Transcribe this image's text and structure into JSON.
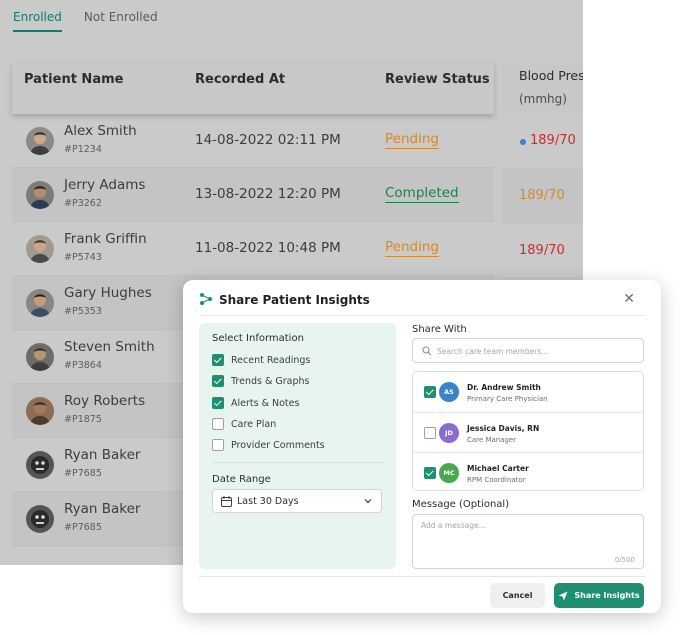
{
  "tabs": [
    {
      "label": "Enrolled",
      "active": true
    },
    {
      "label": "Not Enrolled",
      "active": false
    }
  ],
  "table": {
    "headers": {
      "name": "Patient Name",
      "recorded": "Recorded At",
      "status": "Review Status"
    },
    "rows": [
      {
        "name": "Alex Smith",
        "id": "#P1234",
        "recorded": "14-08-2022  02:11 PM",
        "status": "Pending"
      },
      {
        "name": "Jerry Adams",
        "id": "#P3262",
        "recorded": "13-08-2022  12:20 PM",
        "status": "Completed"
      },
      {
        "name": "Frank Griffin",
        "id": "#P5743",
        "recorded": "11-08-2022  10:48 PM",
        "status": "Pending"
      },
      {
        "name": "Gary Hughes",
        "id": "#P5353"
      },
      {
        "name": "Steven Smith",
        "id": "#P3864"
      },
      {
        "name": "Roy Roberts",
        "id": "#P1875"
      },
      {
        "name": "Ryan Baker",
        "id": "#P7685"
      },
      {
        "name": "Ryan Baker",
        "id": "#P7685"
      }
    ]
  },
  "bp": {
    "title": "Blood Pres",
    "unit": "(mmhg)",
    "values": [
      "189/70",
      "189/70",
      "189/70"
    ],
    "colors": [
      "#cc2c2c",
      "#d38a2a",
      "#cc2c2c"
    ]
  },
  "modal": {
    "title": "Share Patient Insights",
    "select_info_label": "Select Information",
    "options": [
      {
        "label": "Recent Readings",
        "checked": true
      },
      {
        "label": "Trends & Graphs",
        "checked": true
      },
      {
        "label": "Alerts & Notes",
        "checked": true
      },
      {
        "label": "Care Plan",
        "checked": false
      },
      {
        "label": "Provider Comments",
        "checked": false
      }
    ],
    "date_range_label": "Date Range",
    "date_range_value": "Last 30 Days",
    "share_with_label": "Share With",
    "search_placeholder": "Search care team members...",
    "members": [
      {
        "initials": "AS",
        "name": "Dr. Andrew Smith",
        "role": "Primary Care Physician",
        "checked": true,
        "color": "#3b82c9"
      },
      {
        "initials": "JD",
        "name": "Jessica Davis, RN",
        "role": "Care Manager",
        "checked": false,
        "color": "#8a6bd1"
      },
      {
        "initials": "MC",
        "name": "Michael Carter",
        "role": "RPM Coordinator",
        "checked": true,
        "color": "#4aa84f"
      }
    ],
    "message_label": "Message (Optional)",
    "message_placeholder": "Add a message...",
    "char_count": "0/500",
    "cancel_label": "Cancel",
    "share_label": "Share Insights"
  },
  "colors": {
    "accent": "#1f8f72",
    "tab_active": "#167a6a",
    "pending": "#d38a2a",
    "completed": "#1f7f4e"
  }
}
